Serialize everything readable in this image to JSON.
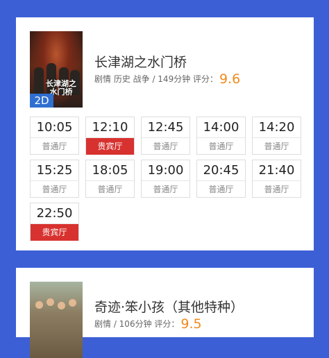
{
  "movies": [
    {
      "title": "长津湖之水门桥",
      "poster_text": "长津湖之水门桥",
      "format_badge": "2D",
      "meta_prefix": "剧情 历史 战争 / 149分钟  评分：",
      "score": "9.6",
      "showtimes": [
        {
          "time": "10:05",
          "hall": "普通厅",
          "vip": false
        },
        {
          "time": "12:10",
          "hall": "贵宾厅",
          "vip": true
        },
        {
          "time": "12:45",
          "hall": "普通厅",
          "vip": false
        },
        {
          "time": "14:00",
          "hall": "普通厅",
          "vip": false
        },
        {
          "time": "14:20",
          "hall": "普通厅",
          "vip": false
        },
        {
          "time": "15:25",
          "hall": "普通厅",
          "vip": false
        },
        {
          "time": "18:05",
          "hall": "普通厅",
          "vip": false
        },
        {
          "time": "19:00",
          "hall": "普通厅",
          "vip": false
        },
        {
          "time": "20:45",
          "hall": "普通厅",
          "vip": false
        },
        {
          "time": "21:40",
          "hall": "普通厅",
          "vip": false
        },
        {
          "time": "22:50",
          "hall": "贵宾厅",
          "vip": true
        }
      ]
    },
    {
      "title": "奇迹·笨小孩（其他特种）",
      "meta_prefix": "剧情 / 106分钟  评分：",
      "score": "9.5"
    }
  ],
  "colors": {
    "page_background": "#3d5fd6",
    "score": "#f08a1c",
    "vip_hall": "#d7322f",
    "badge_2d": "#2f6fd0"
  }
}
